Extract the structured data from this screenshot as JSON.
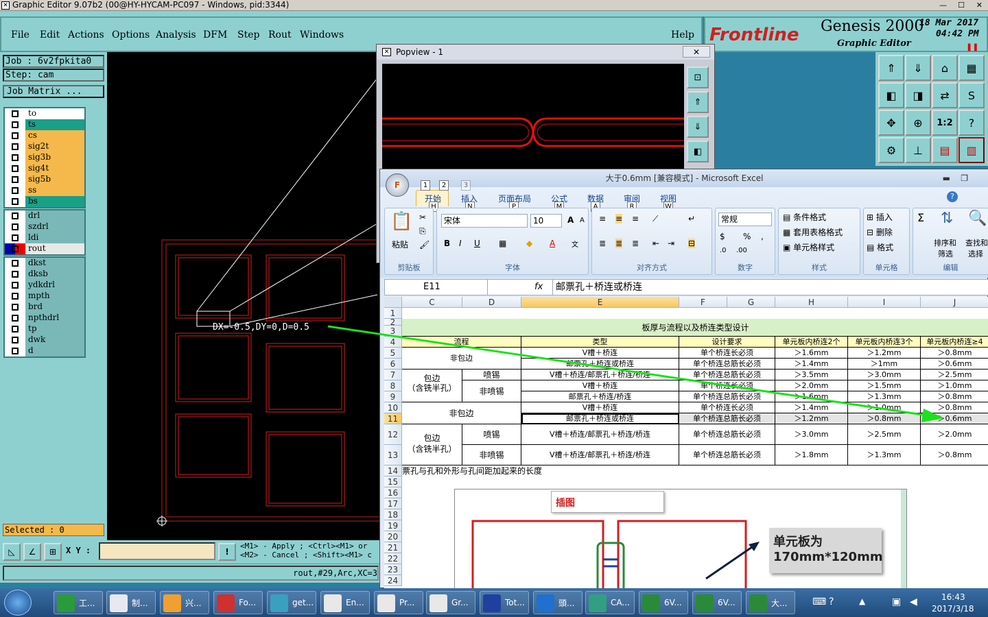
{
  "genesis": {
    "title": "Graphic Editor 9.07b2 (00@HY-HYCAM-PC097 - Windows, pid:3344)",
    "menus": [
      "File",
      "Edit",
      "Actions",
      "Options",
      "Analysis",
      "DFM",
      "Step",
      "Rout",
      "Windows"
    ],
    "help": "Help",
    "brand": "Frontline",
    "product": "Genesis 2000",
    "subtitle": "Graphic Editor",
    "date": "18 Mar 2017",
    "time": "04:42 PM",
    "job": "Job : 6v2fpkita0",
    "step": "Step: cam",
    "job_matrix": "Job Matrix ...",
    "layers1": [
      {
        "name": "to",
        "color": "#ffffff"
      },
      {
        "name": "ts",
        "color": "#1aa088"
      },
      {
        "name": "cs",
        "color": "#f5b84a"
      },
      {
        "name": "sig2t",
        "color": "#f5b84a"
      },
      {
        "name": "sig3b",
        "color": "#f5b84a"
      },
      {
        "name": "sig4t",
        "color": "#f5b84a"
      },
      {
        "name": "sig5b",
        "color": "#f5b84a"
      },
      {
        "name": "ss",
        "color": "#f5b84a"
      },
      {
        "name": "bs",
        "color": "#1aa088"
      }
    ],
    "layers2": [
      {
        "name": "drl",
        "color": "#7ab8b8"
      },
      {
        "name": "szdrl",
        "color": "#7ab8b8"
      },
      {
        "name": "ldi",
        "color": "#7ab8b8"
      },
      {
        "name": "rout",
        "color": "#e8e8e8"
      }
    ],
    "layers3": [
      {
        "name": "dkst",
        "color": "#7ab8b8"
      },
      {
        "name": "dksb",
        "color": "#7ab8b8"
      },
      {
        "name": "ydkdrl",
        "color": "#7ab8b8"
      },
      {
        "name": "mpth",
        "color": "#7ab8b8"
      },
      {
        "name": "brd",
        "color": "#7ab8b8"
      },
      {
        "name": "npthdrl",
        "color": "#7ab8b8"
      },
      {
        "name": "tp",
        "color": "#7ab8b8"
      },
      {
        "name": "dwk",
        "color": "#7ab8b8"
      },
      {
        "name": "d",
        "color": "#7ab8b8"
      }
    ],
    "selected": "Selected : 0",
    "measure": "DX=-0.5,DY=0,D=0.5",
    "xy_label": "X Y :",
    "hint1": "<M1> - Apply ; <Ctrl><M1> or",
    "hint2": "<M2> - Cancel ; <Shift><M1> c",
    "status": "rout,#29,Arc,XC=3"
  },
  "popview": {
    "title": "Popview - 1"
  },
  "excel": {
    "title": "大于0.6mm [兼容模式] - Microsoft Excel",
    "tabs": [
      {
        "label": "开始",
        "key": "H"
      },
      {
        "label": "插入",
        "key": "N"
      },
      {
        "label": "页面布局",
        "key": "P"
      },
      {
        "label": "公式",
        "key": "M"
      },
      {
        "label": "数据",
        "key": "A"
      },
      {
        "label": "审阅",
        "key": "R"
      },
      {
        "label": "视图",
        "key": "W"
      }
    ],
    "qat_keys": [
      "1",
      "2",
      "3"
    ],
    "groups": [
      "剪贴板",
      "字体",
      "对齐方式",
      "数字",
      "样式",
      "单元格",
      "编辑"
    ],
    "paste": "粘贴",
    "font_name": "宋体",
    "font_size": "10",
    "number_format": "常规",
    "styles": [
      "条件格式",
      "套用表格格式",
      "单元格样式"
    ],
    "cells_cmds": [
      "插入",
      "删除",
      "格式"
    ],
    "edit_cmds": [
      "排序和",
      "筛选",
      "查找和",
      "选择"
    ],
    "namebox": "E11",
    "formula": "邮票孔＋桥连或桥连",
    "columns": [
      "C",
      "D",
      "E",
      "F",
      "G",
      "H",
      "I",
      "J"
    ],
    "rows": [
      "1",
      "2",
      "3",
      "4",
      "5",
      "6",
      "7",
      "8",
      "9",
      "10",
      "11",
      "12",
      "13",
      "14",
      "15",
      "16",
      "17",
      "18",
      "19",
      "20",
      "21",
      "22",
      "23",
      "24"
    ],
    "table_title": "板厚与流程以及桥连类型设计",
    "headers": [
      "流程",
      "类型",
      "设计要求",
      "单元板内桥连2个",
      "单元板内桥连3个",
      "单元板内桥连≥4"
    ],
    "r5": [
      "非包边",
      "V槽＋桥连",
      "单个桥连长必须",
      "＞1.6mm",
      "＞1.2mm",
      "＞0.8mm"
    ],
    "r6": [
      "邮票孔＋桥连或桥连",
      "单个桥连总筋长必须",
      "＞1.4mm",
      "＞1mm",
      "＞0.6mm"
    ],
    "r7": [
      "包边",
      "（含铣半孔）",
      "喷锡",
      "V槽＋桥连/邮票孔＋桥连/桥连",
      "单个桥连总筋长必须",
      "＞3.5mm",
      "＞3.0mm",
      "＞2.5mm"
    ],
    "r8": [
      "非喷锡",
      "V槽＋桥连",
      "单个桥连长必须",
      "＞2.0mm",
      "＞1.5mm",
      "＞1.0mm"
    ],
    "r9": [
      "邮票孔＋桥连/桥连",
      "单个桥连总筋长必须",
      "＞1.6mm",
      "＞1.3mm",
      "＞0.8mm"
    ],
    "r10": [
      "非包边",
      "V槽＋桥连",
      "单个桥连长必须",
      "＞1.4mm",
      "＞1.0mm",
      "＞0.8mm"
    ],
    "r11": [
      "邮票孔＋桥连或桥连",
      "单个桥连总筋长必须",
      "＞1.2mm",
      "＞0.8mm",
      "＞0.6mm"
    ],
    "r12": [
      "包边",
      "（含铣半孔）",
      "喷锡",
      "V槽＋桥连/邮票孔＋桥连/桥连",
      "单个桥连总筋长必须",
      "＞3.0mm",
      "＞2.5mm",
      "＞2.0mm"
    ],
    "r13": [
      "非喷锡",
      "V槽＋桥连/邮票孔＋桥连/桥连",
      "单个桥连总筋长必须",
      "＞1.8mm",
      "＞1.3mm",
      "＞0.8mm"
    ],
    "r14": "票孔与孔和外形与孔间距加起来的长度",
    "fig_label": "插图",
    "fig_note1": "单元板为",
    "fig_note2": "170mm*120mm"
  },
  "taskbar": {
    "items": [
      {
        "label": "工...",
        "color": "#2a9a3a"
      },
      {
        "label": "制...",
        "color": "#e8e8f0"
      },
      {
        "label": "兴...",
        "color": "#f0a030"
      },
      {
        "label": "Fo...",
        "color": "#d03030"
      },
      {
        "label": "get...",
        "color": "#3aa0c0"
      },
      {
        "label": "En...",
        "color": "#e8e8e8"
      },
      {
        "label": "Pr...",
        "color": "#e8e8e8"
      },
      {
        "label": "Gr...",
        "color": "#e8e8e8"
      },
      {
        "label": "Tot...",
        "color": "#2040a0"
      },
      {
        "label": "頭...",
        "color": "#2070d0"
      },
      {
        "label": "CA...",
        "color": "#30a080"
      },
      {
        "label": "6V...",
        "color": "#2a8a3a"
      },
      {
        "label": "6V...",
        "color": "#2a8a3a"
      },
      {
        "label": "大...",
        "color": "#2a8a3a"
      }
    ],
    "clock_time": "16:43",
    "clock_date": "2017/3/18"
  }
}
